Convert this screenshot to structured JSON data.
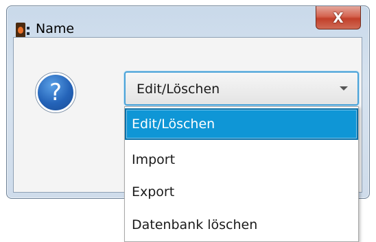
{
  "window": {
    "title": "Name",
    "close_label": "X"
  },
  "dialog": {
    "icon": "question-icon",
    "icon_glyph": "?"
  },
  "combo": {
    "selected": "Edit/Löschen"
  },
  "dropdown": {
    "items": [
      {
        "label": "Edit/Löschen"
      },
      {
        "label": "Import"
      },
      {
        "label": "Export"
      },
      {
        "label": "Datenbank löschen"
      }
    ]
  },
  "colors": {
    "accent": "#0f96d6",
    "focus_border": "#4ba3d8",
    "close_button": "#c2402a"
  }
}
